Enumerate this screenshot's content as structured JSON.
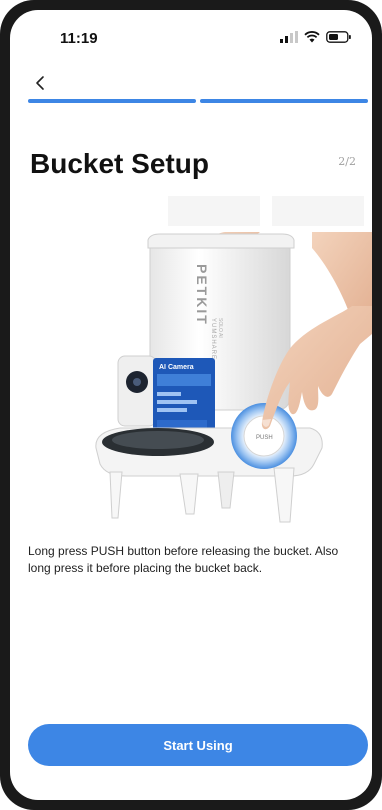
{
  "status_bar": {
    "time": "11:19"
  },
  "header": {
    "back_icon": "chevron-left-icon",
    "title": "Bucket Setup",
    "step": "2/2"
  },
  "progress": {
    "segments": 2,
    "completed": 2,
    "color": "#3d86e5"
  },
  "illustration": {
    "brand": "PETKIT",
    "model": "YUMSHARE",
    "model_sub": "SOLO AI",
    "card_label": "AI Camera",
    "push_label": "PUSH"
  },
  "instructions": "Long press PUSH button before releasing the bucket. Also long press it before placing the bucket back.",
  "action": {
    "start_label": "Start Using"
  },
  "colors": {
    "accent": "#3d86e5"
  }
}
